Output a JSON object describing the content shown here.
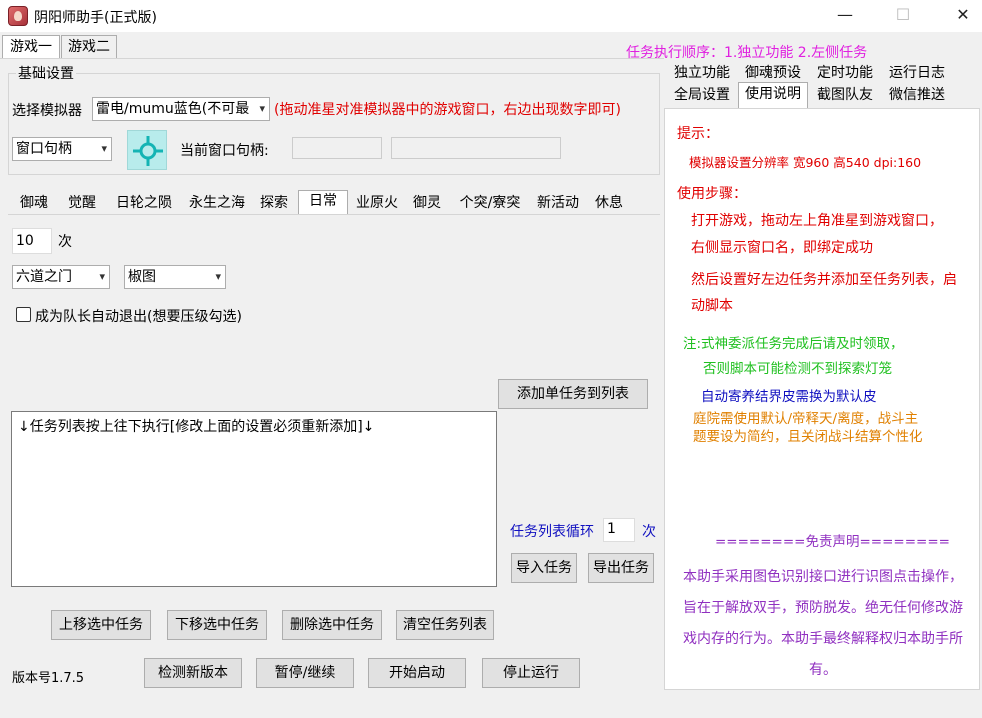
{
  "window": {
    "title": "阴阳师助手(正式版)",
    "minimize_glyph": "—",
    "maximize_glyph": "☐",
    "close_glyph": "✕"
  },
  "game_tabs": [
    "游戏一",
    "游戏二"
  ],
  "basic_settings": {
    "group_label": "基础设置",
    "emulator_label": "选择模拟器",
    "emulator_value": "雷电/mumu蓝色(不可最",
    "drag_hint": "(拖动准星对准模拟器中的游戏窗口，右边出现数字即可)",
    "handle_select": "窗口句柄",
    "crosshair_icon": "crosshair-icon",
    "current_handle_label": "当前窗口句柄:"
  },
  "feature_tabs": [
    "御魂",
    "觉醒",
    "日轮之陨",
    "永生之海",
    "探索",
    "日常",
    "业原火",
    "御灵",
    "个突/寮突",
    "新活动",
    "休息"
  ],
  "daily": {
    "count_value": "10",
    "count_unit": "次",
    "dungeon_select": "六道之门",
    "variant_select": "椒图",
    "auto_exit_label": "成为队长自动退出(想要压级勾选)",
    "add_button": "添加单任务到列表"
  },
  "task_list": {
    "header": "↓任务列表按上往下执行[修改上面的设置必须重新添加]↓",
    "loop_label": "任务列表循环",
    "loop_value": "1",
    "loop_unit": "次",
    "import_button": "导入任务",
    "export_button": "导出任务"
  },
  "bottom_buttons": {
    "move_up": "上移选中任务",
    "move_down": "下移选中任务",
    "delete": "删除选中任务",
    "clear": "清空任务列表",
    "check_update": "检测新版本",
    "pause": "暂停/继续",
    "start": "开始启动",
    "stop": "停止运行",
    "version": "版本号1.7.5"
  },
  "right_panel": {
    "order_note": "任务执行顺序：1.独立功能 2.左侧任务",
    "tabs_row1": [
      "独立功能",
      "御魂预设",
      "定时功能",
      "运行日志"
    ],
    "tabs_row2": [
      "全局设置",
      "使用说明",
      "截图队友",
      "微信推送"
    ],
    "tip_title": "提示：",
    "tip_resolution": "模拟器设置分辨率 宽960 高540 dpi:160",
    "steps_title": "使用步骤：",
    "step1": "打开游戏，拖动左上角准星到游戏窗口，右侧显示窗口名，即绑定成功",
    "step2": "然后设置好左边任务并添加至任务列表，启动脚本",
    "note1": "注:式神委派任务完成后请及时领取，",
    "note2": "否则脚本可能检测不到探索灯笼",
    "note3": "自动寄养结界皮需换为默认皮",
    "note4": "庭院需使用默认/帝释天/离度，战斗主题要设为简约，且关闭战斗结算个性化",
    "disclaimer_title": "========免责声明========",
    "disclaimer_body": "本助手采用图色识别接口进行识图点击操作，旨在于解放双手，预防脱发。绝无任何修改游戏内存的行为。本助手最终解释权归本助手所有。"
  },
  "colors": {
    "magenta": "#e020e0",
    "red": "#e00000",
    "green": "#20c020",
    "blue": "#1010c0",
    "orange": "#e08000",
    "purple": "#9030c0",
    "teal_icon_bg": "#b8ecec",
    "teal_icon": "#14b4b4"
  }
}
